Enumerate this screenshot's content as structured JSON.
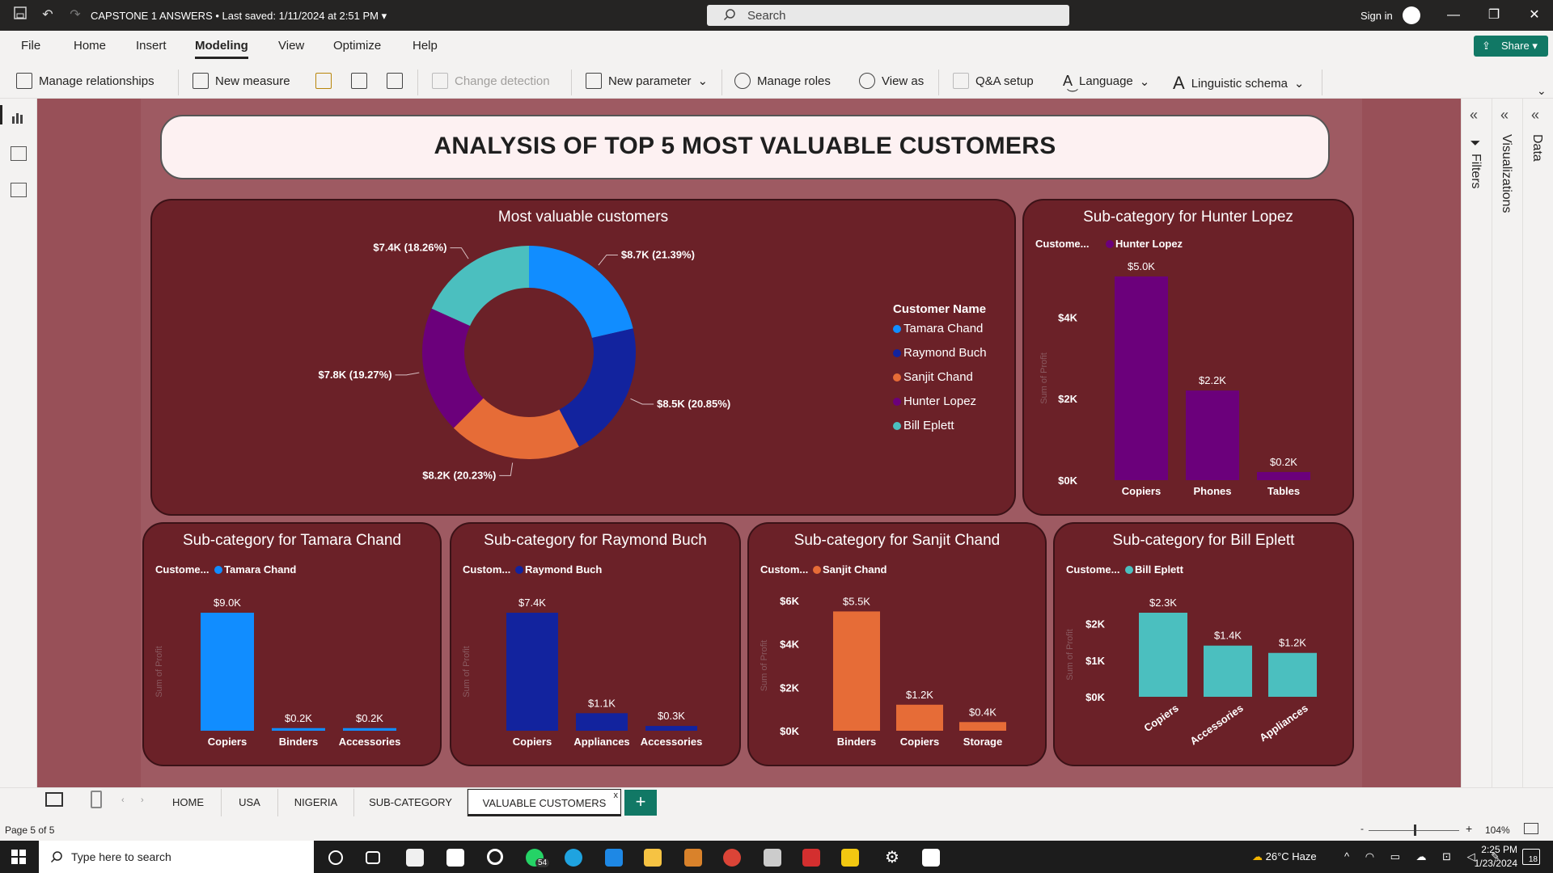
{
  "window": {
    "title": "CAPSTONE 1 ANSWERS • Last saved: 1/11/2024 at 2:51 PM",
    "search_placeholder": "Search",
    "sign_in": "Sign in",
    "share": "Share"
  },
  "menu": [
    "File",
    "Home",
    "Insert",
    "Modeling",
    "View",
    "Optimize",
    "Help"
  ],
  "ribbon": {
    "manage_relationships": "Manage relationships",
    "new_measure": "New measure",
    "change_detection": "Change detection",
    "new_parameter": "New parameter",
    "manage_roles": "Manage roles",
    "view_as": "View as",
    "qa_setup": "Q&A setup",
    "language": "Language",
    "linguistic_schema": "Linguistic schema"
  },
  "panes": {
    "filters": "Filters",
    "visualizations": "Visualizations",
    "data": "Data"
  },
  "report": {
    "title": "ANALYSIS OF TOP 5 MOST VALUABLE CUSTOMERS",
    "donut": {
      "title": "Most valuable customers",
      "legend_title": "Customer Name",
      "slices": [
        {
          "name": "Tamara Chand",
          "label": "$8.7K (21.39%)",
          "value": 21.39,
          "color": "#118dff"
        },
        {
          "name": "Raymond Buch",
          "label": "$8.5K (20.85%)",
          "value": 20.85,
          "color": "#12239e"
        },
        {
          "name": "Sanjit Chand",
          "label": "$8.2K (20.23%)",
          "value": 20.23,
          "color": "#e66c37"
        },
        {
          "name": "Hunter Lopez",
          "label": "$7.8K (19.27%)",
          "value": 19.27,
          "color": "#6b007b"
        },
        {
          "name": "Bill Eplett",
          "label": "$7.4K (18.26%)",
          "value": 18.26,
          "color": "#4bbfbf"
        }
      ]
    },
    "sub_charts": {
      "hunter": {
        "title": "Sub-category for Hunter Lopez",
        "legend_prefix": "Custome...",
        "customer": "Hunter Lopez",
        "color": "#6b007b",
        "ylabel": "Sum of Profit",
        "ymax": 5,
        "ticks": [
          {
            "v": 0,
            "t": "$0K"
          },
          {
            "v": 2,
            "t": "$2K"
          },
          {
            "v": 4,
            "t": "$4K"
          }
        ],
        "categories": [
          "Copiers",
          "Phones",
          "Tables"
        ],
        "values": [
          5.0,
          2.2,
          0.2
        ],
        "labels": [
          "$5.0K",
          "$2.2K",
          "$0.2K"
        ]
      },
      "tamara": {
        "title": "Sub-category for Tamara Chand",
        "legend_prefix": "Custome...",
        "customer": "Tamara Chand",
        "color": "#118dff",
        "ylabel": "Sum of Profit",
        "ymax": 9,
        "ticks": [],
        "categories": [
          "Copiers",
          "Binders",
          "Accessories"
        ],
        "values": [
          9.0,
          0.2,
          0.2
        ],
        "labels": [
          "$9.0K",
          "$0.2K",
          "$0.2K"
        ]
      },
      "raymond": {
        "title": "Sub-category for Raymond Buch",
        "legend_prefix": "Custom...",
        "customer": "Raymond Buch",
        "color": "#12239e",
        "ylabel": "Sum of Profit",
        "ymax": 7.4,
        "ticks": [],
        "categories": [
          "Copiers",
          "Appliances",
          "Accessories"
        ],
        "values": [
          7.4,
          1.1,
          0.3
        ],
        "labels": [
          "$7.4K",
          "$1.1K",
          "$0.3K"
        ]
      },
      "sanjit": {
        "title": "Sub-category for Sanjit Chand",
        "legend_prefix": "Custom...",
        "customer": "Sanjit Chand",
        "color": "#e66c37",
        "ylabel": "Sum of Profit",
        "ymax": 6,
        "ticks": [
          {
            "v": 0,
            "t": "$0K"
          },
          {
            "v": 2,
            "t": "$2K"
          },
          {
            "v": 4,
            "t": "$4K"
          },
          {
            "v": 6,
            "t": "$6K"
          }
        ],
        "categories": [
          "Binders",
          "Copiers",
          "Storage"
        ],
        "values": [
          5.5,
          1.2,
          0.4
        ],
        "labels": [
          "$5.5K",
          "$1.2K",
          "$0.4K"
        ]
      },
      "bill": {
        "title": "Sub-category for Bill Eplett",
        "legend_prefix": "Custome...",
        "customer": "Bill Eplett",
        "color": "#4bbfbf",
        "ylabel": "Sum of Profit",
        "ymax": 2.3,
        "ticks": [
          {
            "v": 0,
            "t": "$0K"
          },
          {
            "v": 1,
            "t": "$1K"
          },
          {
            "v": 2,
            "t": "$2K"
          }
        ],
        "categories": [
          "Copiers",
          "Accessories",
          "Appliances"
        ],
        "values": [
          2.3,
          1.4,
          1.2
        ],
        "labels": [
          "$2.3K",
          "$1.4K",
          "$1.2K"
        ],
        "rotate": true
      }
    }
  },
  "chart_data": [
    {
      "type": "pie",
      "title": "Most valuable customers",
      "categories": [
        "Tamara Chand",
        "Raymond Buch",
        "Sanjit Chand",
        "Hunter Lopez",
        "Bill Eplett"
      ],
      "values": [
        8.7,
        8.5,
        8.2,
        7.8,
        7.4
      ],
      "percent": [
        21.39,
        20.85,
        20.23,
        19.27,
        18.26
      ],
      "legend": "right"
    },
    {
      "type": "bar",
      "title": "Sub-category for Hunter Lopez",
      "categories": [
        "Copiers",
        "Phones",
        "Tables"
      ],
      "values": [
        5.0,
        2.2,
        0.2
      ],
      "ylabel": "Sum of Profit"
    },
    {
      "type": "bar",
      "title": "Sub-category for Tamara Chand",
      "categories": [
        "Copiers",
        "Binders",
        "Accessories"
      ],
      "values": [
        9.0,
        0.2,
        0.2
      ],
      "ylabel": "Sum of Profit"
    },
    {
      "type": "bar",
      "title": "Sub-category for Raymond Buch",
      "categories": [
        "Copiers",
        "Appliances",
        "Accessories"
      ],
      "values": [
        7.4,
        1.1,
        0.3
      ],
      "ylabel": "Sum of Profit"
    },
    {
      "type": "bar",
      "title": "Sub-category for Sanjit Chand",
      "categories": [
        "Binders",
        "Copiers",
        "Storage"
      ],
      "values": [
        5.5,
        1.2,
        0.4
      ],
      "ylabel": "Sum of Profit",
      "ylim": [
        0,
        6
      ]
    },
    {
      "type": "bar",
      "title": "Sub-category for Bill Eplett",
      "categories": [
        "Copiers",
        "Accessories",
        "Appliances"
      ],
      "values": [
        2.3,
        1.4,
        1.2
      ],
      "ylabel": "Sum of Profit"
    }
  ],
  "pages": {
    "tabs": [
      "HOME",
      "USA",
      "NIGERIA",
      "SUB-CATEGORY",
      "VALUABLE CUSTOMERS"
    ],
    "active": "VALUABLE CUSTOMERS",
    "page_count": "Page 5 of 5",
    "zoom": "104%"
  },
  "taskbar": {
    "search_placeholder": "Type here to search",
    "whatsapp_badge": "54",
    "weather": "26°C  Haze",
    "time": "2:25 PM",
    "date": "1/23/2024",
    "notif_count": "18"
  }
}
